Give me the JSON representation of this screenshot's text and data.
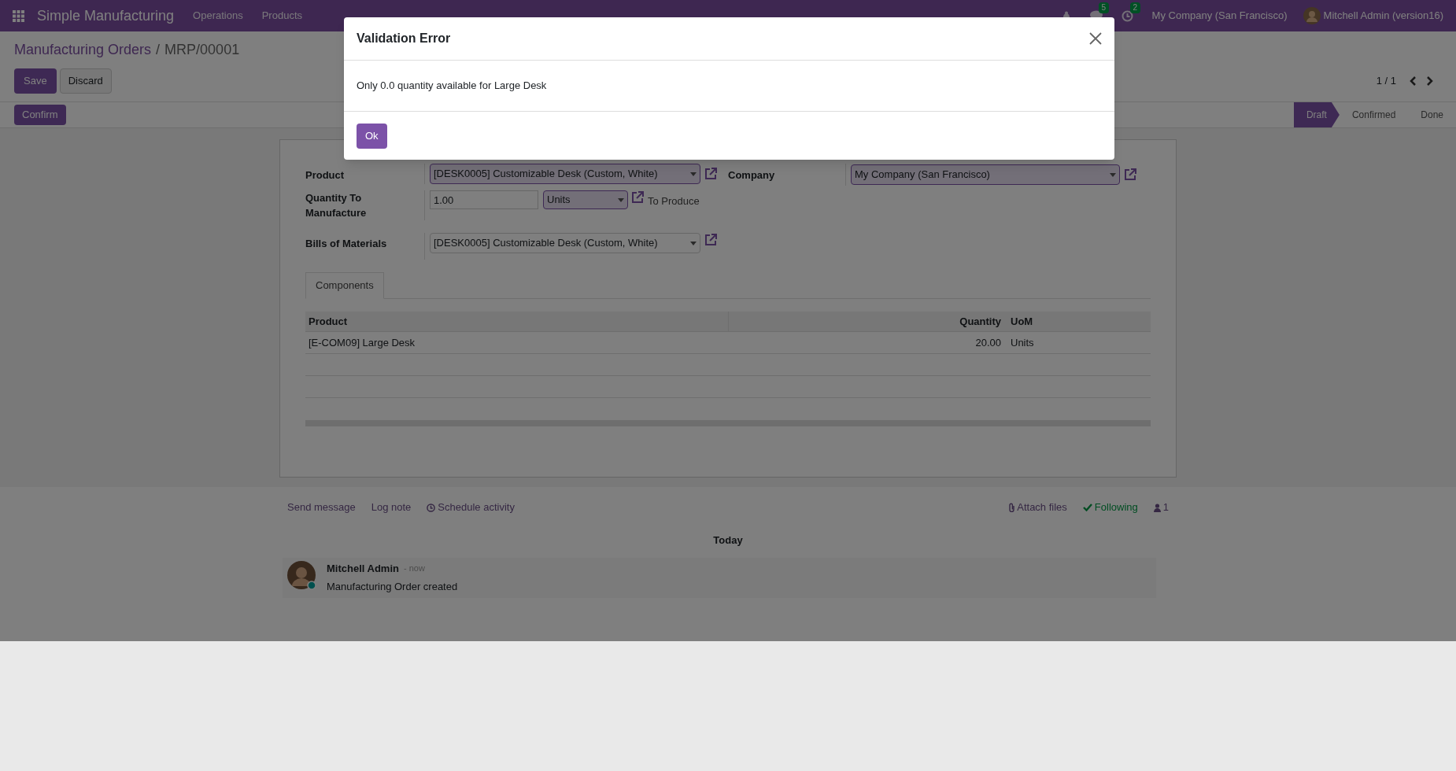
{
  "navbar": {
    "app_name": "Simple Manufacturing",
    "menu": [
      "Operations",
      "Products"
    ],
    "messages_count": "5",
    "activities_count": "2",
    "company": "My Company (San Francisco)",
    "user": "Mitchell Admin (version16)"
  },
  "control_panel": {
    "breadcrumb": [
      "Manufacturing Orders",
      "MRP/00001"
    ],
    "breadcrumb_separator": "/",
    "save": "Save",
    "discard": "Discard",
    "pager": "1 / 1",
    "action": "Confirm",
    "stages": [
      {
        "label": "Draft",
        "selected": true
      },
      {
        "label": "Confirmed",
        "selected": false
      },
      {
        "label": "Done",
        "selected": false
      }
    ]
  },
  "form": {
    "product": {
      "label": "Product",
      "value": "[DESK0005] Customizable Desk (Custom, White)"
    },
    "company": {
      "label": "Company",
      "value": "My Company (San Francisco)"
    },
    "quantity": {
      "label": "Quantity To Manufacture",
      "value": "1.00",
      "uom": "Units",
      "suffix": "To Produce"
    },
    "bom": {
      "label": "Bills of Materials",
      "value": "[DESK0005] Customizable Desk (Custom, White)"
    },
    "tabs": [
      {
        "label": "Components",
        "selected": true
      }
    ],
    "table": {
      "columns": [
        "Product",
        "Quantity",
        "UoM"
      ],
      "rows": [
        [
          "[E-COM09] Large Desk",
          "20.00",
          "Units"
        ]
      ]
    }
  },
  "chatter": {
    "actions": [
      "Send message",
      "Log note",
      "Schedule activity"
    ],
    "attach": "Attach files",
    "following": "Following",
    "followers": "1",
    "date": "Today",
    "messages": [
      {
        "author": "Mitchell Admin",
        "time": "- now",
        "body": "Manufacturing Order created"
      }
    ]
  },
  "dialog": {
    "title": "Validation Error",
    "body": "Only 0.0 quantity available for Large Desk",
    "button": "Ok"
  }
}
